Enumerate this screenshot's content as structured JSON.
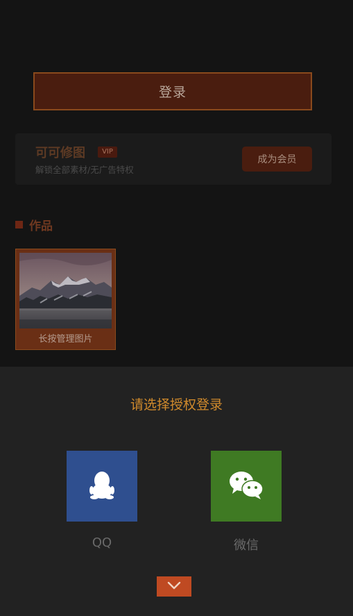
{
  "login": {
    "label": "登录"
  },
  "vip": {
    "title": "可可修图",
    "badge": "VIP",
    "subtitle": "解锁全部素材/无广告特权",
    "join_label": "成为会员"
  },
  "works": {
    "title": "作品",
    "items": [
      {
        "caption": "长按管理图片",
        "image": "mountain-lake-landscape"
      }
    ]
  },
  "auth_sheet": {
    "title": "请选择授权登录",
    "options": [
      {
        "label": "QQ",
        "icon": "qq-penguin-icon",
        "color": "#2f4f8f"
      },
      {
        "label": "微信",
        "icon": "wechat-icon",
        "color": "#3f7a23"
      }
    ],
    "close_icon": "chevron-down-icon",
    "close_color": "#bf4a22"
  }
}
